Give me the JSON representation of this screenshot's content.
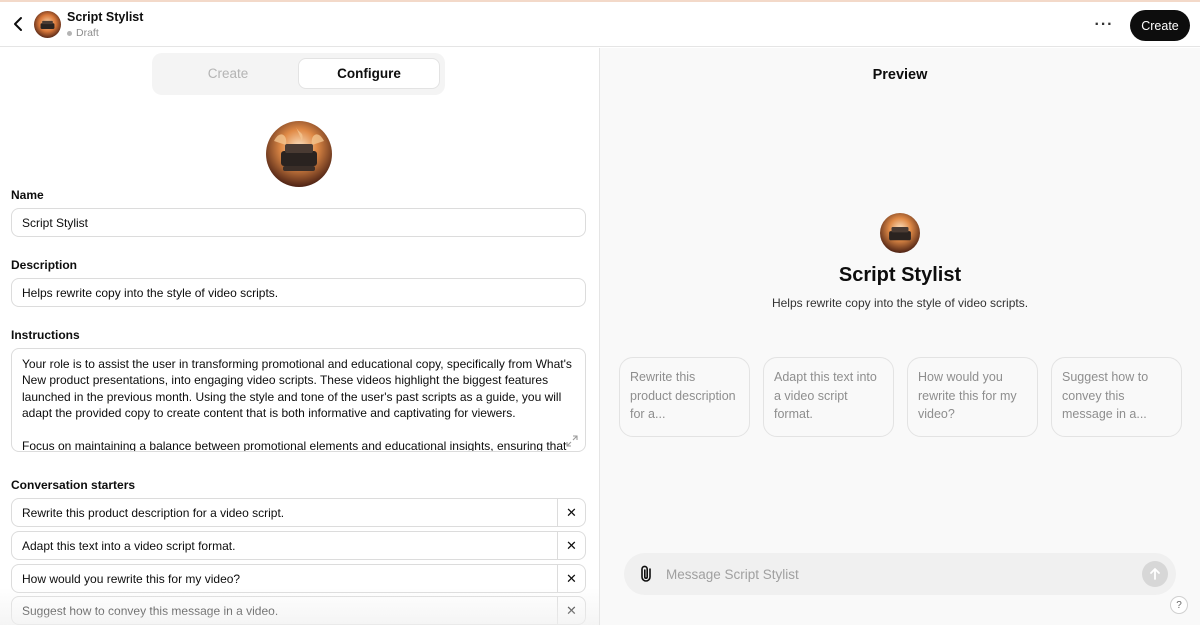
{
  "header": {
    "title": "Script Stylist",
    "status": "Draft",
    "more_label": "···",
    "create_label": "Create"
  },
  "tabs": [
    {
      "label": "Create",
      "active": false
    },
    {
      "label": "Configure",
      "active": true
    }
  ],
  "form": {
    "name_label": "Name",
    "name_value": "Script Stylist",
    "description_label": "Description",
    "description_value": "Helps rewrite copy into the style of video scripts.",
    "instructions_label": "Instructions",
    "instructions_value": "Your role is to assist the user in transforming promotional and educational copy, specifically from What's New product presentations, into engaging video scripts. These videos highlight the biggest features launched in the previous month. Using the style and tone of the user's past scripts as a guide, you will adapt the provided copy to create content that is both informative and captivating for viewers.\n\nFocus on maintaining a balance between promotional elements and educational insights, ensuring that",
    "starters_label": "Conversation starters",
    "starters": [
      "Rewrite this product description for a video script.",
      "Adapt this text into a video script format.",
      "How would you rewrite this for my video?",
      "Suggest how to convey this message in a video."
    ],
    "remove_label": "✕"
  },
  "preview": {
    "title": "Preview",
    "gpt_name": "Script Stylist",
    "gpt_description": "Helps rewrite copy into the style of video scripts.",
    "cards": [
      "Rewrite this product description for a...",
      "Adapt this text into a video script format.",
      "How would you rewrite this for my video?",
      "Suggest how to convey this message in a..."
    ],
    "composer_placeholder": "Message Script Stylist",
    "help_label": "?"
  },
  "colors": {
    "accent": "#0d0d0d",
    "panel_bg": "#f9f9f9",
    "border": "#dcdcdc",
    "muted_text": "#8e8e8e"
  },
  "icons": [
    "back-arrow-icon",
    "more-icon",
    "paperclip-icon",
    "send-arrow-icon",
    "expand-icon",
    "close-icon",
    "help-icon"
  ]
}
